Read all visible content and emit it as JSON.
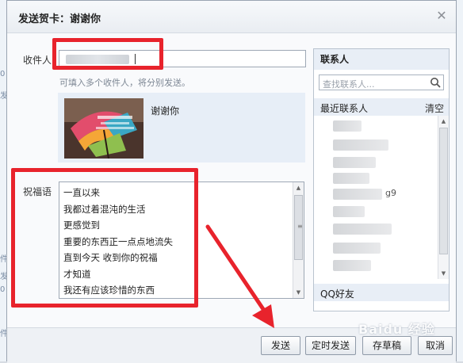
{
  "dialog": {
    "title": "发送贺卡：谢谢你",
    "close_icon": "close-icon"
  },
  "recipient": {
    "label": "收件人",
    "hint": "可填入多个收件人，将分别发送。"
  },
  "card": {
    "title": "谢谢你"
  },
  "message": {
    "label": "祝福语",
    "lines": [
      "一直以来",
      "我都过着混沌的生活",
      "更感觉到",
      "重要的东西正一点点地流失",
      "直到今天 收到你的祝福",
      "才知道",
      "我还有应该珍惜的东西"
    ]
  },
  "contacts": {
    "header": "联系人",
    "search_placeholder": "查找联系人...",
    "search_icon": "search-icon",
    "recent_label": "最近联系人",
    "clear_label": "清空",
    "visible_suffix": "g9",
    "qq_friends_label": "QQ好友"
  },
  "footer": {
    "send": "发送",
    "scheduled_send": "定时发送",
    "save_draft": "存草稿",
    "cancel": "取消"
  },
  "background": {
    "side_chars": [
      "0",
      "发",
      "件",
      "发",
      "0",
      "件"
    ]
  },
  "watermark": "Baidu 经验",
  "colors": {
    "annotation_red": "#e8232c",
    "panel_header": "#e8eef6"
  }
}
